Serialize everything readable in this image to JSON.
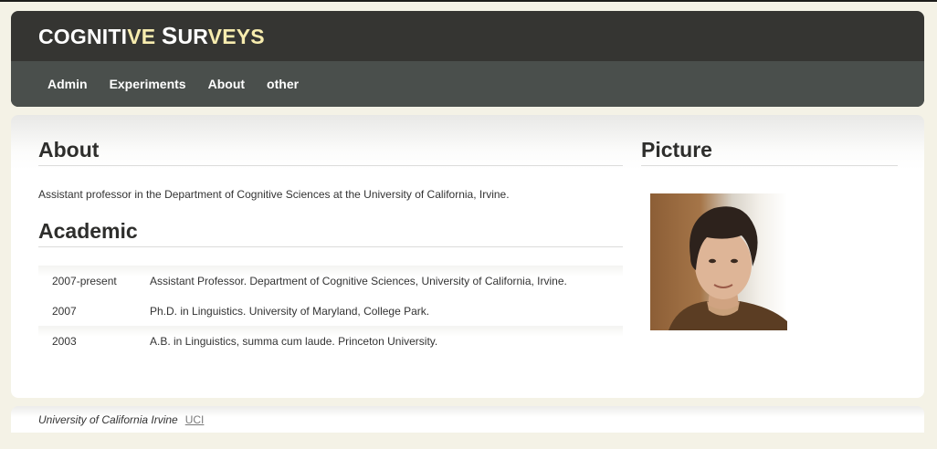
{
  "brand": {
    "part1": "Cogniti",
    "part2": "ve ",
    "part3": "S",
    "part4": "ur",
    "part5": "veys"
  },
  "nav": {
    "items": [
      {
        "label": "Admin"
      },
      {
        "label": "Experiments"
      },
      {
        "label": "About"
      },
      {
        "label": "other"
      }
    ]
  },
  "about": {
    "heading": "About",
    "text": "Assistant professor in the Department of Cognitive Sciences at the University of California, Irvine."
  },
  "academic": {
    "heading": "Academic",
    "rows": [
      {
        "year": "2007-present",
        "desc": "Assistant Professor. Department of Cognitive Sciences, University of California, Irvine."
      },
      {
        "year": "2007",
        "desc": "Ph.D. in Linguistics. University of Maryland, College Park."
      },
      {
        "year": "2003",
        "desc": "A.B. in Linguistics, summa cum laude. Princeton University."
      }
    ]
  },
  "picture": {
    "heading": "Picture"
  },
  "footer": {
    "institution": "University of California Irvine",
    "link": "UCI"
  },
  "colors": {
    "header_bg": "#353532",
    "nav_bg": "#4a4f4c",
    "brand_accent": "#f7ecae",
    "page_bg": "#f4f2e6"
  }
}
